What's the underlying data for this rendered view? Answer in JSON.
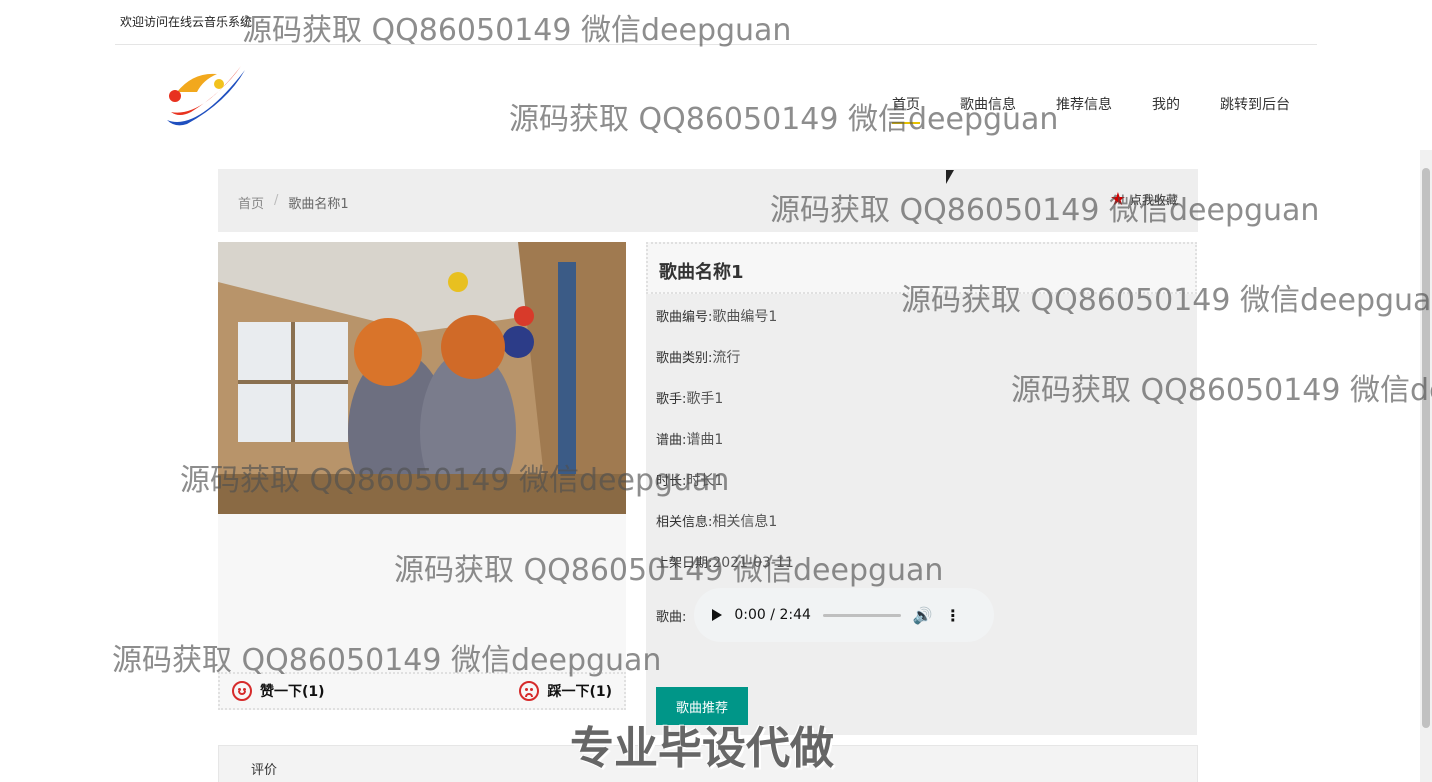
{
  "topbar": {
    "welcome": "欢迎访问在线云音乐系统"
  },
  "nav": [
    {
      "label": "首页"
    },
    {
      "label": "歌曲信息"
    },
    {
      "label": "推荐信息"
    },
    {
      "label": "我的"
    },
    {
      "label": "跳转到后台"
    }
  ],
  "breadcrumb": {
    "home": "首页",
    "separator": "/",
    "current": "歌曲名称1",
    "favorite": "点我收藏"
  },
  "song": {
    "title": "歌曲名称1",
    "fields": [
      {
        "label": "歌曲编号:",
        "value": "歌曲编号1"
      },
      {
        "label": "歌曲类别:",
        "value": "流行"
      },
      {
        "label": "歌手:",
        "value": "歌手1"
      },
      {
        "label": "谱曲:",
        "value": "谱曲1"
      },
      {
        "label": "时长:",
        "value": "时长1"
      },
      {
        "label": "相关信息:",
        "value": "相关信息1"
      },
      {
        "label": "上架日期:",
        "value": "2021-03-11"
      }
    ],
    "audio_label": "歌曲:",
    "audio_time": "0:00 / 2:44",
    "recommend_button": "歌曲推荐"
  },
  "votes": {
    "like": "赞一下(1)",
    "dislike": "踩一下(1)"
  },
  "comments": {
    "tab": "评价"
  },
  "watermarks": {
    "text": "源码获取 QQ86050149 微信deepguan",
    "banner": "专业毕设代做"
  },
  "colors": {
    "accent": "#009688",
    "nav_underline": "#e6c100",
    "star": "#d10000",
    "vote_icon": "#d62b2b"
  }
}
